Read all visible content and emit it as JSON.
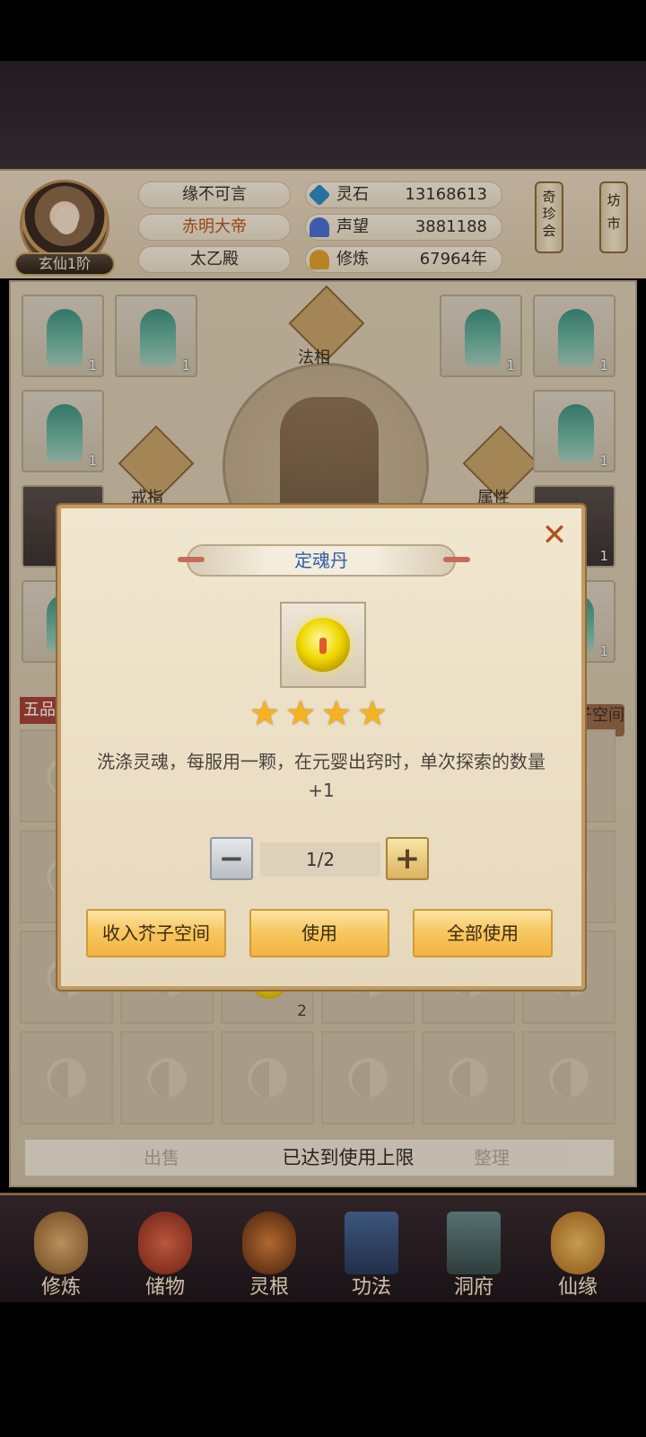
{
  "header": {
    "rank": "玄仙1阶",
    "player_name": "缘不可言",
    "title": "赤明大帝",
    "location": "太乙殿",
    "resources": [
      {
        "label": "灵石",
        "value": "13168613",
        "icon": "spirit-stone-icon",
        "color": "#2f8ac0"
      },
      {
        "label": "声望",
        "value": "3881188",
        "icon": "reputation-crystal-icon",
        "color": "#4b6fd0"
      },
      {
        "label": "修炼",
        "value": "67964年",
        "icon": "meditation-icon",
        "color": "#e0a030"
      }
    ],
    "side_buttons": [
      {
        "label": "奇珍会"
      },
      {
        "label": "坊市"
      }
    ]
  },
  "equipment": {
    "center_label": "法相",
    "left_label": "戒指",
    "right_label": "属性",
    "storage_label": "芥子空间",
    "slot_counts": [
      "1",
      "1",
      "1",
      "1",
      "1",
      "1",
      "1",
      "1",
      "1"
    ]
  },
  "inventory": {
    "grade_tab": "五品",
    "item_count": "2"
  },
  "action_bar": {
    "sell_label": "出售",
    "sort_label": "整理",
    "toast": "已达到使用上限"
  },
  "dialog": {
    "title": "定魂丹",
    "close_label": "✕",
    "stars": 4,
    "star_glyphs": [
      "★",
      "★",
      "★",
      "★"
    ],
    "description": "洗涤灵魂，每服用一颗，在元婴出窍时，单次探索的数量+1",
    "quantity": "1/2",
    "minus_label": "−",
    "plus_label": "+",
    "buttons": {
      "store": "收入芥子空间",
      "use": "使用",
      "use_all": "全部使用"
    }
  },
  "nav": {
    "items": [
      {
        "label": "修炼",
        "icon": "cultivation-icon"
      },
      {
        "label": "储物",
        "icon": "storage-bag-icon"
      },
      {
        "label": "灵根",
        "icon": "spirit-root-icon"
      },
      {
        "label": "功法",
        "icon": "technique-book-icon"
      },
      {
        "label": "洞府",
        "icon": "cave-dwelling-icon"
      },
      {
        "label": "仙缘",
        "icon": "immortal-fate-icon"
      }
    ]
  }
}
